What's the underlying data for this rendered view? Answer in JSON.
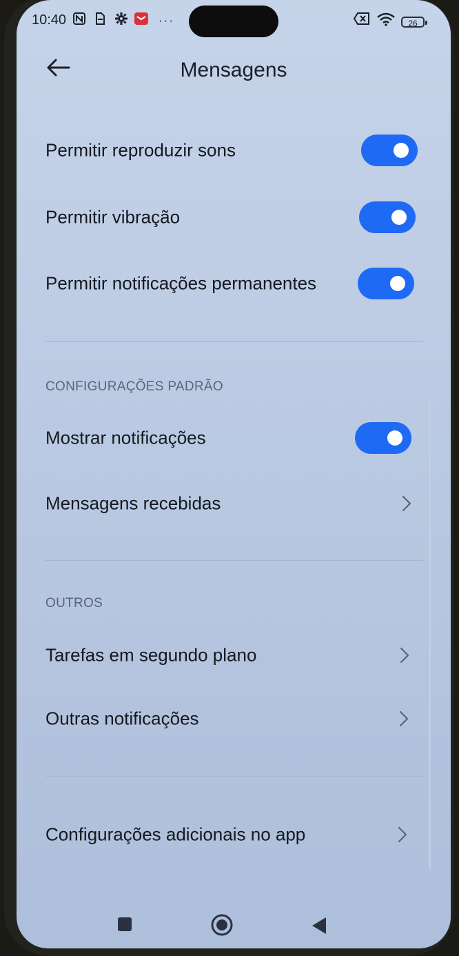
{
  "status_bar": {
    "time": "10:40",
    "icons": [
      "nfc-icon",
      "sim-icon",
      "gear-icon",
      "mail-icon",
      "more-icon"
    ],
    "battery": "26"
  },
  "header": {
    "title": "Mensagens"
  },
  "toggles": [
    {
      "label": "Permitir reproduzir sons",
      "on": true
    },
    {
      "label": "Permitir vibração",
      "on": true
    },
    {
      "label": "Permitir notificações permanentes",
      "on": true
    }
  ],
  "default_section": {
    "title": "CONFIGURAÇÕES PADRÃO",
    "show_notifications": {
      "label": "Mostrar notificações",
      "on": true
    },
    "received_messages": {
      "label": "Mensagens recebidas"
    }
  },
  "others_section": {
    "title": "OUTROS",
    "items": [
      {
        "label": "Tarefas em segundo plano"
      },
      {
        "label": "Outras notificações"
      }
    ]
  },
  "additional": {
    "label": "Configurações adicionais no app"
  },
  "colors": {
    "accent": "#1f6af4",
    "background": "#bccbe3",
    "text": "#15191f"
  }
}
